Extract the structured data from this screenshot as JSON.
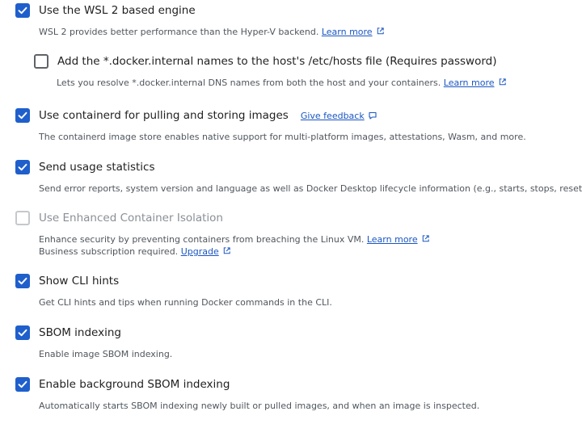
{
  "settings": {
    "wsl2": {
      "label": "Use the WSL 2 based engine",
      "checked": true,
      "description": "WSL 2 provides better performance than the Hyper-V backend.",
      "link": "Learn more"
    },
    "docker_internal": {
      "label": "Add the *.docker.internal names to the host's /etc/hosts file (Requires password)",
      "checked": false,
      "description": "Lets you resolve *.docker.internal DNS names from both the host and your containers.",
      "link": "Learn more"
    },
    "containerd": {
      "label": "Use containerd for pulling and storing images",
      "checked": true,
      "feedback": "Give feedback",
      "description": "The containerd image store enables native support for multi-platform images, attestations, Wasm, and more."
    },
    "usage_stats": {
      "label": "Send usage statistics",
      "checked": true,
      "description": "Send error reports, system version and language as well as Docker Desktop lifecycle information (e.g., starts, stops, resets)."
    },
    "eci": {
      "label": "Use Enhanced Container Isolation",
      "checked": false,
      "disabled": true,
      "description_line1": "Enhance security by preventing containers from breaching the Linux VM.",
      "link": "Learn more",
      "description_line2": "Business subscription required.",
      "upgrade_link": "Upgrade"
    },
    "cli_hints": {
      "label": "Show CLI hints",
      "checked": true,
      "description": "Get CLI hints and tips when running Docker commands in the CLI."
    },
    "sbom": {
      "label": "SBOM indexing",
      "checked": true,
      "description": "Enable image SBOM indexing."
    },
    "bg_sbom": {
      "label": "Enable background SBOM indexing",
      "checked": true,
      "description": "Automatically starts SBOM indexing newly built or pulled images, and when an image is inspected."
    }
  },
  "colors": {
    "accent": "#1f5fcc",
    "link": "#1a56c2",
    "text": "#1f1f1f",
    "muted": "#50565c",
    "disabled": "#8a8f95"
  }
}
